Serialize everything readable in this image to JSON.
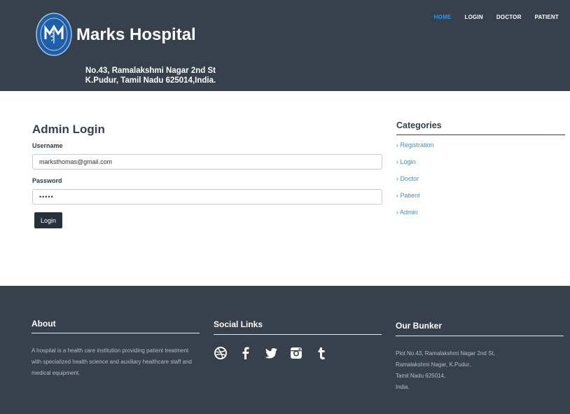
{
  "header": {
    "brand": "Marks Hospital",
    "address_line1": "No.43, Ramalakshmi Nagar 2nd St",
    "address_line2": "K.Pudur, Tamil Nadu 625014,India.",
    "logo_text": "MARKS HOSPITAL"
  },
  "nav": {
    "items": [
      {
        "label": "HOME",
        "active": true
      },
      {
        "label": "LOGIN",
        "active": false
      },
      {
        "label": "DOCTOR",
        "active": false
      },
      {
        "label": "PATIENT",
        "active": false
      }
    ]
  },
  "login": {
    "title": "Admin Login",
    "username_label": "Username",
    "username_value": "marksthomas@gmail.com",
    "password_label": "Password",
    "password_value": "•••••",
    "button_label": "Login"
  },
  "categories": {
    "title": "Categories",
    "items": [
      "› Registration",
      "› Login",
      "› Doctor",
      "› Patient",
      "› Admin"
    ]
  },
  "footer": {
    "about_title": "About",
    "about_text": "A hospital is a health care institution providing patient treatment with specialized health science and auxiliary healthcare staff and medical equipment.",
    "social_title": "Social Links",
    "social_icons": [
      "dribbble-icon",
      "facebook-icon",
      "twitter-icon",
      "instagram-icon",
      "tumblr-icon"
    ],
    "bunker_title": "Our Bunker",
    "bunker_lines": [
      "Plot No.43, Ramalakshmi Nagar 2nd St,",
      "Ramalakshmi Nagar, K.Pudur,",
      "Tamil Nadu 625014,",
      "India."
    ]
  },
  "colors": {
    "dark": "#37404d",
    "accent": "#1f9ee8",
    "link": "#3a8fd1"
  }
}
